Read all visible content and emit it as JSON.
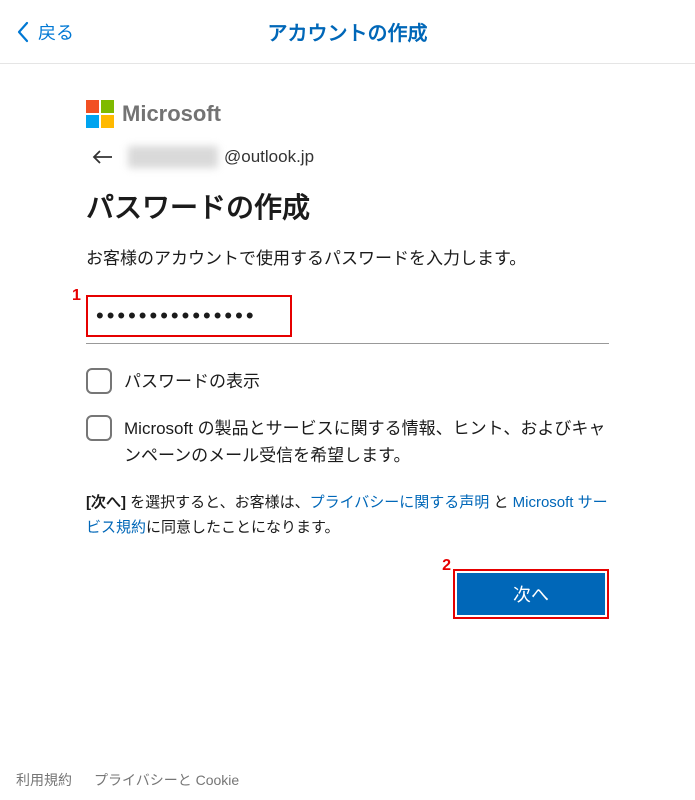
{
  "nav": {
    "back_label": "戻る",
    "title": "アカウントの作成"
  },
  "brand": {
    "name": "Microsoft"
  },
  "email": {
    "domain": "@outlook.jp"
  },
  "heading": "パスワードの作成",
  "subtitle": "お客様のアカウントで使用するパスワードを入力します。",
  "password": {
    "value": "•••••••••••••••"
  },
  "checkboxes": {
    "show_password_label": "パスワードの表示",
    "marketing_label": "Microsoft の製品とサービスに関する情報、ヒント、およびキャンペーンのメール受信を希望します。"
  },
  "legal": {
    "prefix_bold": "[次へ]",
    "text1": " を選択すると、お客様は、",
    "privacy_link": "プライバシーに関する声明",
    "text2": " と ",
    "terms_link": "Microsoft サービス規約",
    "text3": "に同意したことになります。"
  },
  "buttons": {
    "next": "次へ"
  },
  "footer": {
    "terms": "利用規約",
    "privacy": "プライバシーと Cookie"
  },
  "annotations": {
    "one": "1",
    "two": "2"
  }
}
